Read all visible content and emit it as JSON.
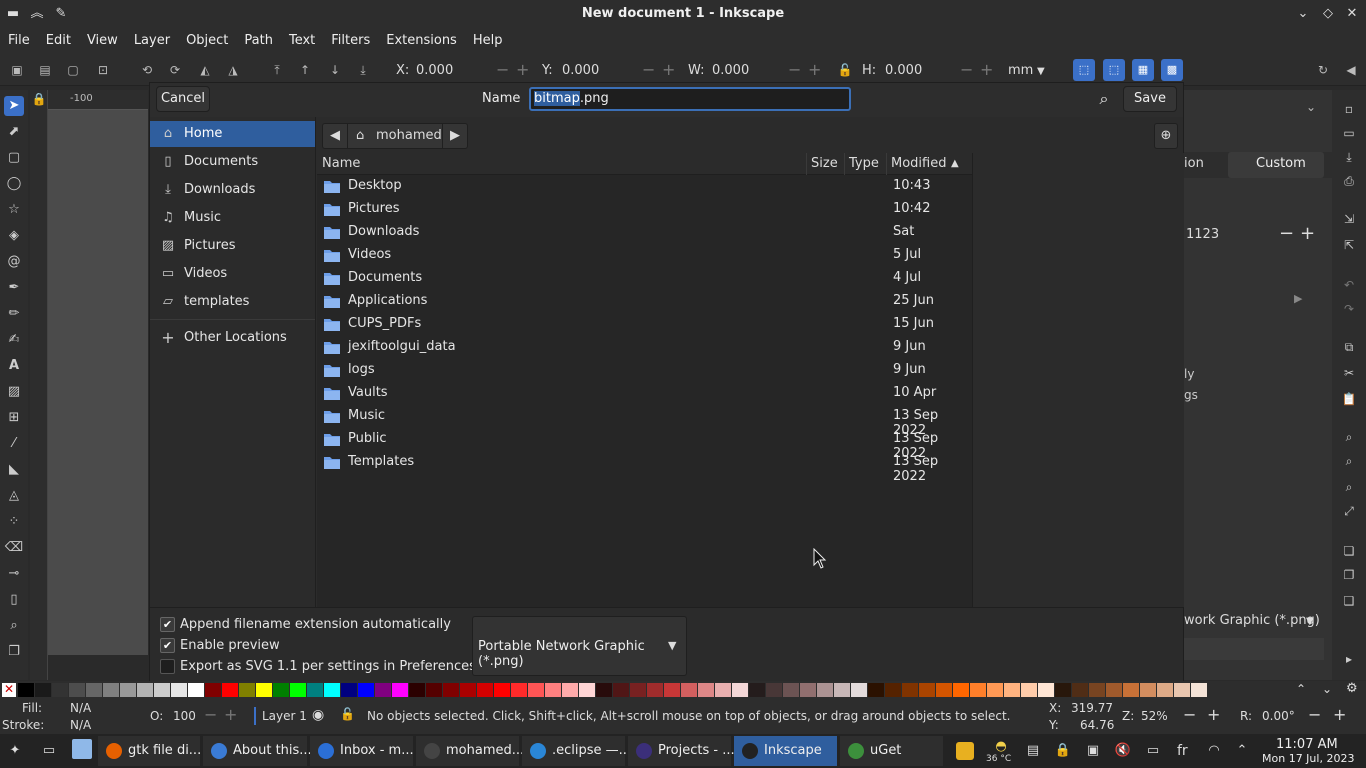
{
  "window": {
    "title": "New document 1 - Inkscape"
  },
  "menubar": [
    "File",
    "Edit",
    "View",
    "Layer",
    "Object",
    "Path",
    "Text",
    "Filters",
    "Extensions",
    "Help"
  ],
  "toolbar": {
    "x_label": "X:",
    "x_value": "0.000",
    "y_label": "Y:",
    "y_value": "0.000",
    "w_label": "W:",
    "w_value": "0.000",
    "h_label": "H:",
    "h_value": "0.000",
    "unit": "mm"
  },
  "ruler": {
    "h_tick": "-100"
  },
  "dialog": {
    "cancel_label": "Cancel",
    "name_label": "Name",
    "name_selected": "bitmap",
    "name_rest": ".png",
    "save_label": "Save",
    "places": [
      {
        "label": "Home",
        "icon": "home-icon"
      },
      {
        "label": "Documents",
        "icon": "documents-icon"
      },
      {
        "label": "Downloads",
        "icon": "download-icon"
      },
      {
        "label": "Music",
        "icon": "music-icon"
      },
      {
        "label": "Pictures",
        "icon": "pictures-icon"
      },
      {
        "label": "Videos",
        "icon": "videos-icon"
      },
      {
        "label": "templates",
        "icon": "folder-icon"
      }
    ],
    "other_locations": "Other Locations",
    "path_current": "mohamed",
    "columns": {
      "name": "Name",
      "size": "Size",
      "type": "Type",
      "modified": "Modified"
    },
    "files": [
      {
        "name": "Desktop",
        "modified": "10:43"
      },
      {
        "name": "Pictures",
        "modified": "10:42"
      },
      {
        "name": "Downloads",
        "modified": "Sat"
      },
      {
        "name": "Videos",
        "modified": "5 Jul"
      },
      {
        "name": "Documents",
        "modified": "4 Jul"
      },
      {
        "name": "Applications",
        "modified": "25 Jun"
      },
      {
        "name": "CUPS_PDFs",
        "modified": "15 Jun"
      },
      {
        "name": "jexiftoolgui_data",
        "modified": "9 Jun"
      },
      {
        "name": "logs",
        "modified": "9 Jun"
      },
      {
        "name": "Vaults",
        "modified": "10 Apr"
      },
      {
        "name": "Music",
        "modified": "13 Sep 2022"
      },
      {
        "name": "Public",
        "modified": "13 Sep 2022"
      },
      {
        "name": "Templates",
        "modified": "13 Sep 2022"
      }
    ],
    "options": [
      {
        "label": "Append filename extension automatically",
        "checked": true
      },
      {
        "label": "Enable preview",
        "checked": true
      },
      {
        "label": "Export as SVG 1.1 per settings in Preferences dialog",
        "checked": false
      }
    ],
    "filter_value": "Portable Network Graphic (*.png)"
  },
  "right_panel": {
    "tab_partial": "ion",
    "tab_custom": "Custom",
    "value_partial": "1123",
    "text1": "ly",
    "text2": "gs",
    "filter_partial": "work Graphic (*.png)"
  },
  "statusbar": {
    "fill_label": "Fill:",
    "fill_value": "N/A",
    "stroke_label": "Stroke:",
    "stroke_value": "N/A",
    "opacity_label": "O:",
    "opacity_value": "100",
    "layer": "Layer 1",
    "message": "No objects selected. Click, Shift+click, Alt+scroll mouse on top of objects, or drag around objects to select.",
    "x_label": "X:",
    "x_value": "319.77",
    "y_label": "Y:",
    "y_value": "64.76",
    "zoom_label": "Z:",
    "zoom_value": "52%",
    "rotate_label": "R:",
    "rotate_value": "0.00°"
  },
  "taskbar": {
    "tasks": [
      {
        "label": "gtk file di...",
        "color": "#e66000"
      },
      {
        "label": "About this...",
        "color": "#3a7bd5"
      },
      {
        "label": "Inbox - m...",
        "color": "#2b6fd6"
      },
      {
        "label": "mohamed...",
        "color": "#444444"
      },
      {
        "label": ".eclipse —...",
        "color": "#2a86d6"
      },
      {
        "label": "Projects - ...",
        "color": "#3b2f7a"
      },
      {
        "label": "Inkscape",
        "color": "#222222"
      },
      {
        "label": "uGet",
        "color": "#3c8f3c"
      }
    ],
    "temperature": "36 °C",
    "keyboard": "fr",
    "time": "11:07 AM",
    "date": "Mon 17 Jul, 2023"
  },
  "colors": {
    "accent": "#2f5e9e",
    "folder": "#6d9ee8"
  }
}
